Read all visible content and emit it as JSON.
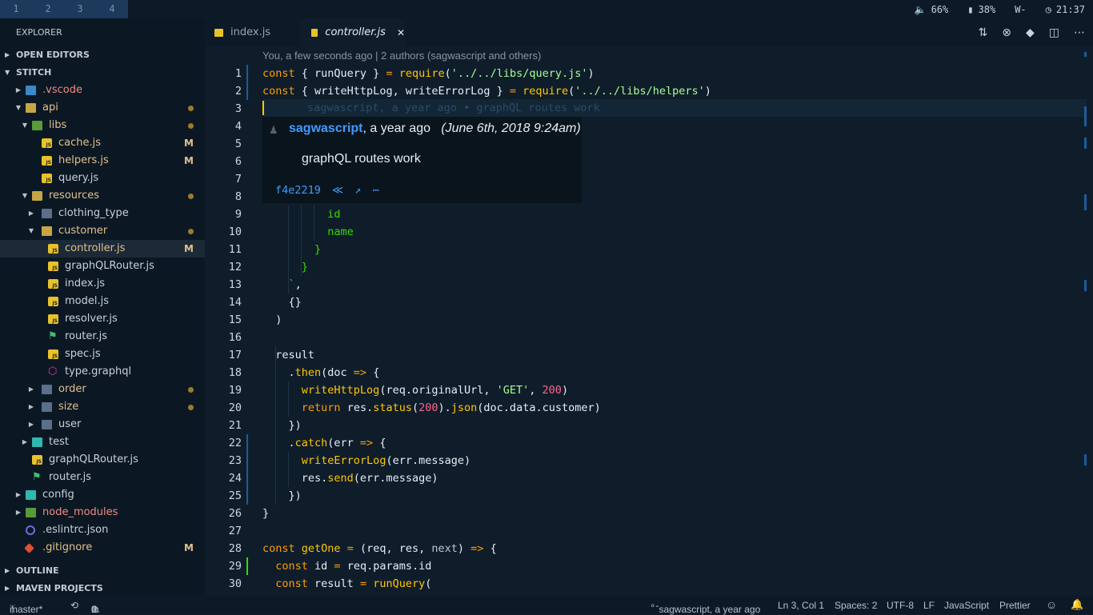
{
  "workspaces": [
    "1",
    "2",
    "3",
    "4"
  ],
  "tray": {
    "volume_icon": "speaker-icon",
    "volume": "66%",
    "battery_icon": "battery-icon",
    "battery": "38%",
    "wifi": "W-",
    "clock_icon": "clock-icon",
    "time": "21:37"
  },
  "sidebar": {
    "title": "EXPLORER",
    "open_editors": "OPEN EDITORS",
    "project": "STITCH",
    "outline": "OUTLINE",
    "maven": "MAVEN PROJECTS",
    "tree": [
      {
        "label": ".vscode",
        "type": "fdb",
        "indent": 1,
        "arrow": "right",
        "color": "#f08a80"
      },
      {
        "label": "api",
        "type": "fdo",
        "indent": 1,
        "arrow": "down",
        "color": "#e2c08d",
        "dot": true
      },
      {
        "label": "libs",
        "type": "fdg",
        "indent": 2,
        "arrow": "down",
        "color": "#e2c08d",
        "dot": true
      },
      {
        "label": "cache.js",
        "type": "jsi",
        "indent": 3,
        "color": "#e2c08d",
        "mark": "M"
      },
      {
        "label": "helpers.js",
        "type": "jsi",
        "indent": 3,
        "color": "#e2c08d",
        "mark": "M"
      },
      {
        "label": "query.js",
        "type": "jsi",
        "indent": 3,
        "color": "#c8d0d8"
      },
      {
        "label": "resources",
        "type": "fdo",
        "indent": 2,
        "arrow": "down",
        "color": "#e2c08d",
        "dot": true
      },
      {
        "label": "clothing_type",
        "type": "fd",
        "indent": 3,
        "arrow": "right",
        "color": "#c8d0d8"
      },
      {
        "label": "customer",
        "type": "fdo",
        "indent": 3,
        "arrow": "down",
        "color": "#e2c08d",
        "dot": true
      },
      {
        "label": "controller.js",
        "type": "jsi",
        "indent": 4,
        "color": "#e2c08d",
        "mark": "M",
        "selected": true
      },
      {
        "label": "graphQLRouter.js",
        "type": "jsi",
        "indent": 4,
        "color": "#c8d0d8"
      },
      {
        "label": "index.js",
        "type": "jsi",
        "indent": 4,
        "color": "#c8d0d8"
      },
      {
        "label": "model.js",
        "type": "jsi",
        "indent": 4,
        "color": "#c8d0d8"
      },
      {
        "label": "resolver.js",
        "type": "jsi",
        "indent": 4,
        "color": "#c8d0d8"
      },
      {
        "label": "router.js",
        "type": "rt",
        "indent": 4,
        "color": "#c8d0d8"
      },
      {
        "label": "spec.js",
        "type": "jsi",
        "indent": 4,
        "color": "#c8d0d8"
      },
      {
        "label": "type.graphql",
        "type": "gq",
        "indent": 4,
        "color": "#c8d0d8"
      },
      {
        "label": "order",
        "type": "fd",
        "indent": 3,
        "arrow": "right",
        "color": "#e2c08d",
        "dot": true
      },
      {
        "label": "size",
        "type": "fd",
        "indent": 3,
        "arrow": "right",
        "color": "#e2c08d",
        "dot": true
      },
      {
        "label": "user",
        "type": "fd",
        "indent": 3,
        "arrow": "right",
        "color": "#c8d0d8"
      },
      {
        "label": "test",
        "type": "fdt",
        "indent": 2,
        "arrow": "right",
        "color": "#c8d0d8"
      },
      {
        "label": "graphQLRouter.js",
        "type": "jsi",
        "indent": 2,
        "color": "#c8d0d8"
      },
      {
        "label": "router.js",
        "type": "rt",
        "indent": 2,
        "color": "#c8d0d8"
      },
      {
        "label": "config",
        "type": "fdt",
        "indent": 1,
        "arrow": "right",
        "color": "#c8d0d8"
      },
      {
        "label": "node_modules",
        "type": "fdg",
        "indent": 1,
        "arrow": "right",
        "color": "#f08a80"
      },
      {
        "label": ".eslintrc.json",
        "type": "es",
        "indent": 1,
        "color": "#c8d0d8"
      },
      {
        "label": ".gitignore",
        "type": "git",
        "indent": 1,
        "color": "#e2c08d",
        "mark": "M"
      }
    ]
  },
  "tabs": [
    {
      "label": "index.js",
      "active": false
    },
    {
      "label": "controller.js",
      "active": true
    }
  ],
  "tab_close": "✕",
  "editor": {
    "codelens": "You, a few seconds ago | 2 authors (sagwascript and others)",
    "line_numbers": [
      "1",
      "2",
      "3",
      "4",
      "5",
      "6",
      "7",
      "8",
      "9",
      "10",
      "11",
      "12",
      "13",
      "14",
      "15",
      "16",
      "17",
      "18",
      "19",
      "20",
      "21",
      "22",
      "23",
      "24",
      "25",
      "26",
      "27",
      "28",
      "29",
      "30"
    ],
    "line3_blame": "sagwascript, a year ago • graphQL routes work",
    "hover": {
      "author": "sagwascript",
      "when": ", a year ago",
      "date": "(June 6th, 2018 9:24am)",
      "message": "graphQL routes work",
      "sha": "f4e2219",
      "actions": "≪ ↗ ⋯"
    }
  },
  "status": {
    "branch": "master*",
    "sync": "⟲",
    "errors": "0",
    "warnings": "0",
    "blame": "sagwascript, a year ago",
    "position": "Ln 3, Col 1",
    "spaces": "Spaces: 2",
    "encoding": "UTF-8",
    "eol": "LF",
    "language": "JavaScript",
    "formatter": "Prettier",
    "smiley_icon": "smiley-icon",
    "bell_icon": "bell-icon"
  }
}
